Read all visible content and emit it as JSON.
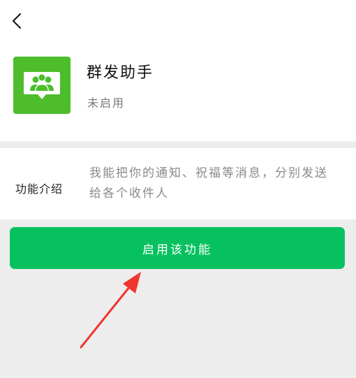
{
  "nav": {
    "back_icon": "chevron-left-icon"
  },
  "app": {
    "icon": "group-chat-icon",
    "icon_color": "#4dbd2c",
    "name": "群发助手",
    "status": "未启用"
  },
  "description": {
    "label": "功能介绍",
    "text": "我能把你的通知、祝福等消息，分别发送给各个收件人"
  },
  "actions": {
    "enable_label": "启用该功能",
    "enable_color": "#07c160"
  },
  "annotation": {
    "arrow_color": "#f0362e"
  }
}
